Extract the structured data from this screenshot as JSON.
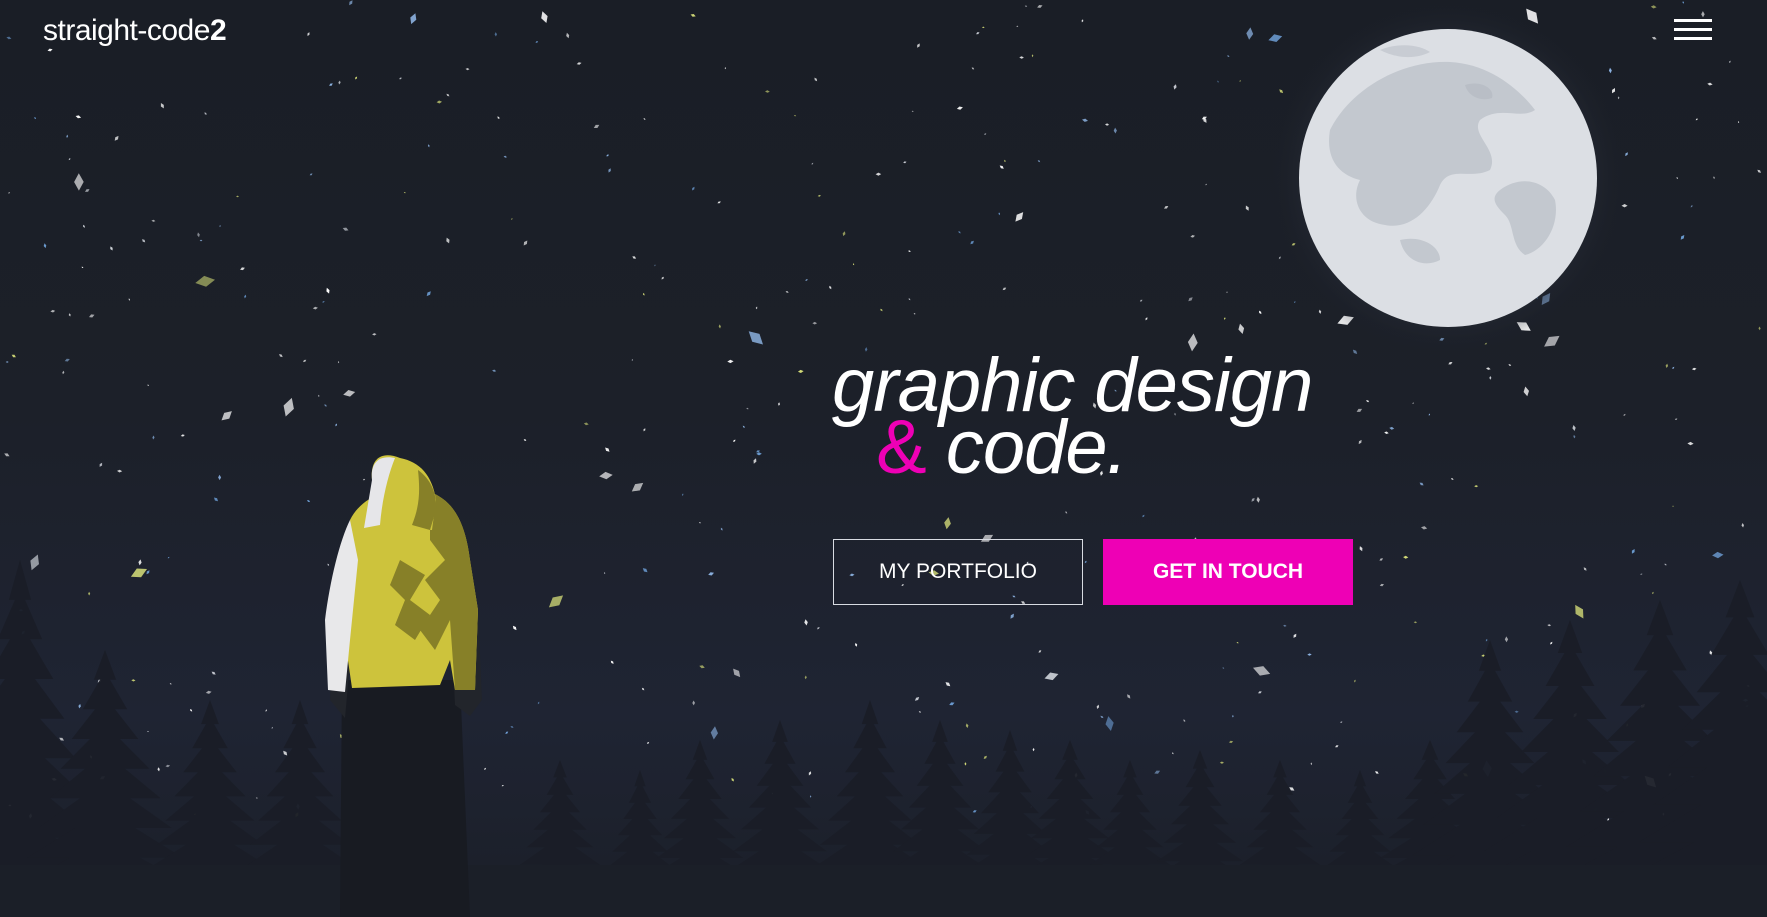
{
  "brand": {
    "name": "straight-code",
    "version": "2"
  },
  "menu": {
    "icon": "hamburger-menu-icon"
  },
  "hero": {
    "headline_line1": "graphic design",
    "headline_amp": "&",
    "headline_line2": "code."
  },
  "buttons": {
    "portfolio_label": "MY PORTFOLIO",
    "contact_label": "GET IN TOUCH"
  },
  "colors": {
    "background": "#1b1f28",
    "accent": "#ee00b5",
    "jacket": "#cdc33c",
    "moon": "#dcdfe4"
  }
}
